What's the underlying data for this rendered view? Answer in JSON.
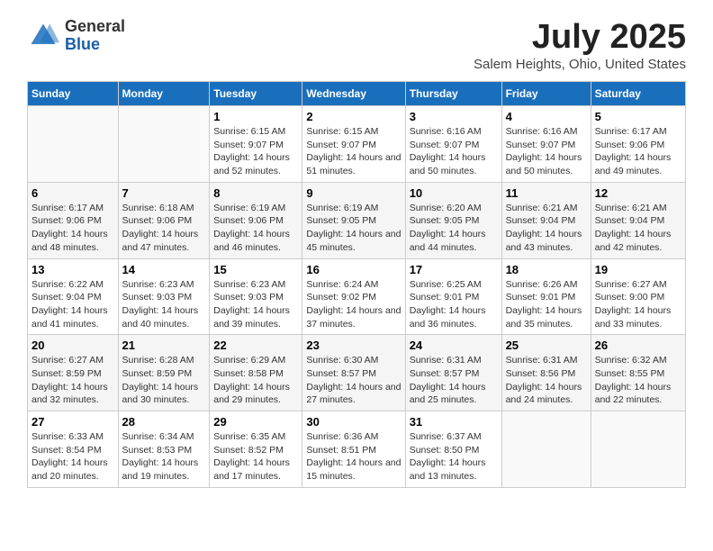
{
  "logo": {
    "text_general": "General",
    "text_blue": "Blue"
  },
  "header": {
    "month_year": "July 2025",
    "location": "Salem Heights, Ohio, United States"
  },
  "weekdays": [
    "Sunday",
    "Monday",
    "Tuesday",
    "Wednesday",
    "Thursday",
    "Friday",
    "Saturday"
  ],
  "weeks": [
    [
      {
        "day": "",
        "sunrise": "",
        "sunset": "",
        "daylight": ""
      },
      {
        "day": "",
        "sunrise": "",
        "sunset": "",
        "daylight": ""
      },
      {
        "day": "1",
        "sunrise": "Sunrise: 6:15 AM",
        "sunset": "Sunset: 9:07 PM",
        "daylight": "Daylight: 14 hours and 52 minutes."
      },
      {
        "day": "2",
        "sunrise": "Sunrise: 6:15 AM",
        "sunset": "Sunset: 9:07 PM",
        "daylight": "Daylight: 14 hours and 51 minutes."
      },
      {
        "day": "3",
        "sunrise": "Sunrise: 6:16 AM",
        "sunset": "Sunset: 9:07 PM",
        "daylight": "Daylight: 14 hours and 50 minutes."
      },
      {
        "day": "4",
        "sunrise": "Sunrise: 6:16 AM",
        "sunset": "Sunset: 9:07 PM",
        "daylight": "Daylight: 14 hours and 50 minutes."
      },
      {
        "day": "5",
        "sunrise": "Sunrise: 6:17 AM",
        "sunset": "Sunset: 9:06 PM",
        "daylight": "Daylight: 14 hours and 49 minutes."
      }
    ],
    [
      {
        "day": "6",
        "sunrise": "Sunrise: 6:17 AM",
        "sunset": "Sunset: 9:06 PM",
        "daylight": "Daylight: 14 hours and 48 minutes."
      },
      {
        "day": "7",
        "sunrise": "Sunrise: 6:18 AM",
        "sunset": "Sunset: 9:06 PM",
        "daylight": "Daylight: 14 hours and 47 minutes."
      },
      {
        "day": "8",
        "sunrise": "Sunrise: 6:19 AM",
        "sunset": "Sunset: 9:06 PM",
        "daylight": "Daylight: 14 hours and 46 minutes."
      },
      {
        "day": "9",
        "sunrise": "Sunrise: 6:19 AM",
        "sunset": "Sunset: 9:05 PM",
        "daylight": "Daylight: 14 hours and 45 minutes."
      },
      {
        "day": "10",
        "sunrise": "Sunrise: 6:20 AM",
        "sunset": "Sunset: 9:05 PM",
        "daylight": "Daylight: 14 hours and 44 minutes."
      },
      {
        "day": "11",
        "sunrise": "Sunrise: 6:21 AM",
        "sunset": "Sunset: 9:04 PM",
        "daylight": "Daylight: 14 hours and 43 minutes."
      },
      {
        "day": "12",
        "sunrise": "Sunrise: 6:21 AM",
        "sunset": "Sunset: 9:04 PM",
        "daylight": "Daylight: 14 hours and 42 minutes."
      }
    ],
    [
      {
        "day": "13",
        "sunrise": "Sunrise: 6:22 AM",
        "sunset": "Sunset: 9:04 PM",
        "daylight": "Daylight: 14 hours and 41 minutes."
      },
      {
        "day": "14",
        "sunrise": "Sunrise: 6:23 AM",
        "sunset": "Sunset: 9:03 PM",
        "daylight": "Daylight: 14 hours and 40 minutes."
      },
      {
        "day": "15",
        "sunrise": "Sunrise: 6:23 AM",
        "sunset": "Sunset: 9:03 PM",
        "daylight": "Daylight: 14 hours and 39 minutes."
      },
      {
        "day": "16",
        "sunrise": "Sunrise: 6:24 AM",
        "sunset": "Sunset: 9:02 PM",
        "daylight": "Daylight: 14 hours and 37 minutes."
      },
      {
        "day": "17",
        "sunrise": "Sunrise: 6:25 AM",
        "sunset": "Sunset: 9:01 PM",
        "daylight": "Daylight: 14 hours and 36 minutes."
      },
      {
        "day": "18",
        "sunrise": "Sunrise: 6:26 AM",
        "sunset": "Sunset: 9:01 PM",
        "daylight": "Daylight: 14 hours and 35 minutes."
      },
      {
        "day": "19",
        "sunrise": "Sunrise: 6:27 AM",
        "sunset": "Sunset: 9:00 PM",
        "daylight": "Daylight: 14 hours and 33 minutes."
      }
    ],
    [
      {
        "day": "20",
        "sunrise": "Sunrise: 6:27 AM",
        "sunset": "Sunset: 8:59 PM",
        "daylight": "Daylight: 14 hours and 32 minutes."
      },
      {
        "day": "21",
        "sunrise": "Sunrise: 6:28 AM",
        "sunset": "Sunset: 8:59 PM",
        "daylight": "Daylight: 14 hours and 30 minutes."
      },
      {
        "day": "22",
        "sunrise": "Sunrise: 6:29 AM",
        "sunset": "Sunset: 8:58 PM",
        "daylight": "Daylight: 14 hours and 29 minutes."
      },
      {
        "day": "23",
        "sunrise": "Sunrise: 6:30 AM",
        "sunset": "Sunset: 8:57 PM",
        "daylight": "Daylight: 14 hours and 27 minutes."
      },
      {
        "day": "24",
        "sunrise": "Sunrise: 6:31 AM",
        "sunset": "Sunset: 8:57 PM",
        "daylight": "Daylight: 14 hours and 25 minutes."
      },
      {
        "day": "25",
        "sunrise": "Sunrise: 6:31 AM",
        "sunset": "Sunset: 8:56 PM",
        "daylight": "Daylight: 14 hours and 24 minutes."
      },
      {
        "day": "26",
        "sunrise": "Sunrise: 6:32 AM",
        "sunset": "Sunset: 8:55 PM",
        "daylight": "Daylight: 14 hours and 22 minutes."
      }
    ],
    [
      {
        "day": "27",
        "sunrise": "Sunrise: 6:33 AM",
        "sunset": "Sunset: 8:54 PM",
        "daylight": "Daylight: 14 hours and 20 minutes."
      },
      {
        "day": "28",
        "sunrise": "Sunrise: 6:34 AM",
        "sunset": "Sunset: 8:53 PM",
        "daylight": "Daylight: 14 hours and 19 minutes."
      },
      {
        "day": "29",
        "sunrise": "Sunrise: 6:35 AM",
        "sunset": "Sunset: 8:52 PM",
        "daylight": "Daylight: 14 hours and 17 minutes."
      },
      {
        "day": "30",
        "sunrise": "Sunrise: 6:36 AM",
        "sunset": "Sunset: 8:51 PM",
        "daylight": "Daylight: 14 hours and 15 minutes."
      },
      {
        "day": "31",
        "sunrise": "Sunrise: 6:37 AM",
        "sunset": "Sunset: 8:50 PM",
        "daylight": "Daylight: 14 hours and 13 minutes."
      },
      {
        "day": "",
        "sunrise": "",
        "sunset": "",
        "daylight": ""
      },
      {
        "day": "",
        "sunrise": "",
        "sunset": "",
        "daylight": ""
      }
    ]
  ]
}
